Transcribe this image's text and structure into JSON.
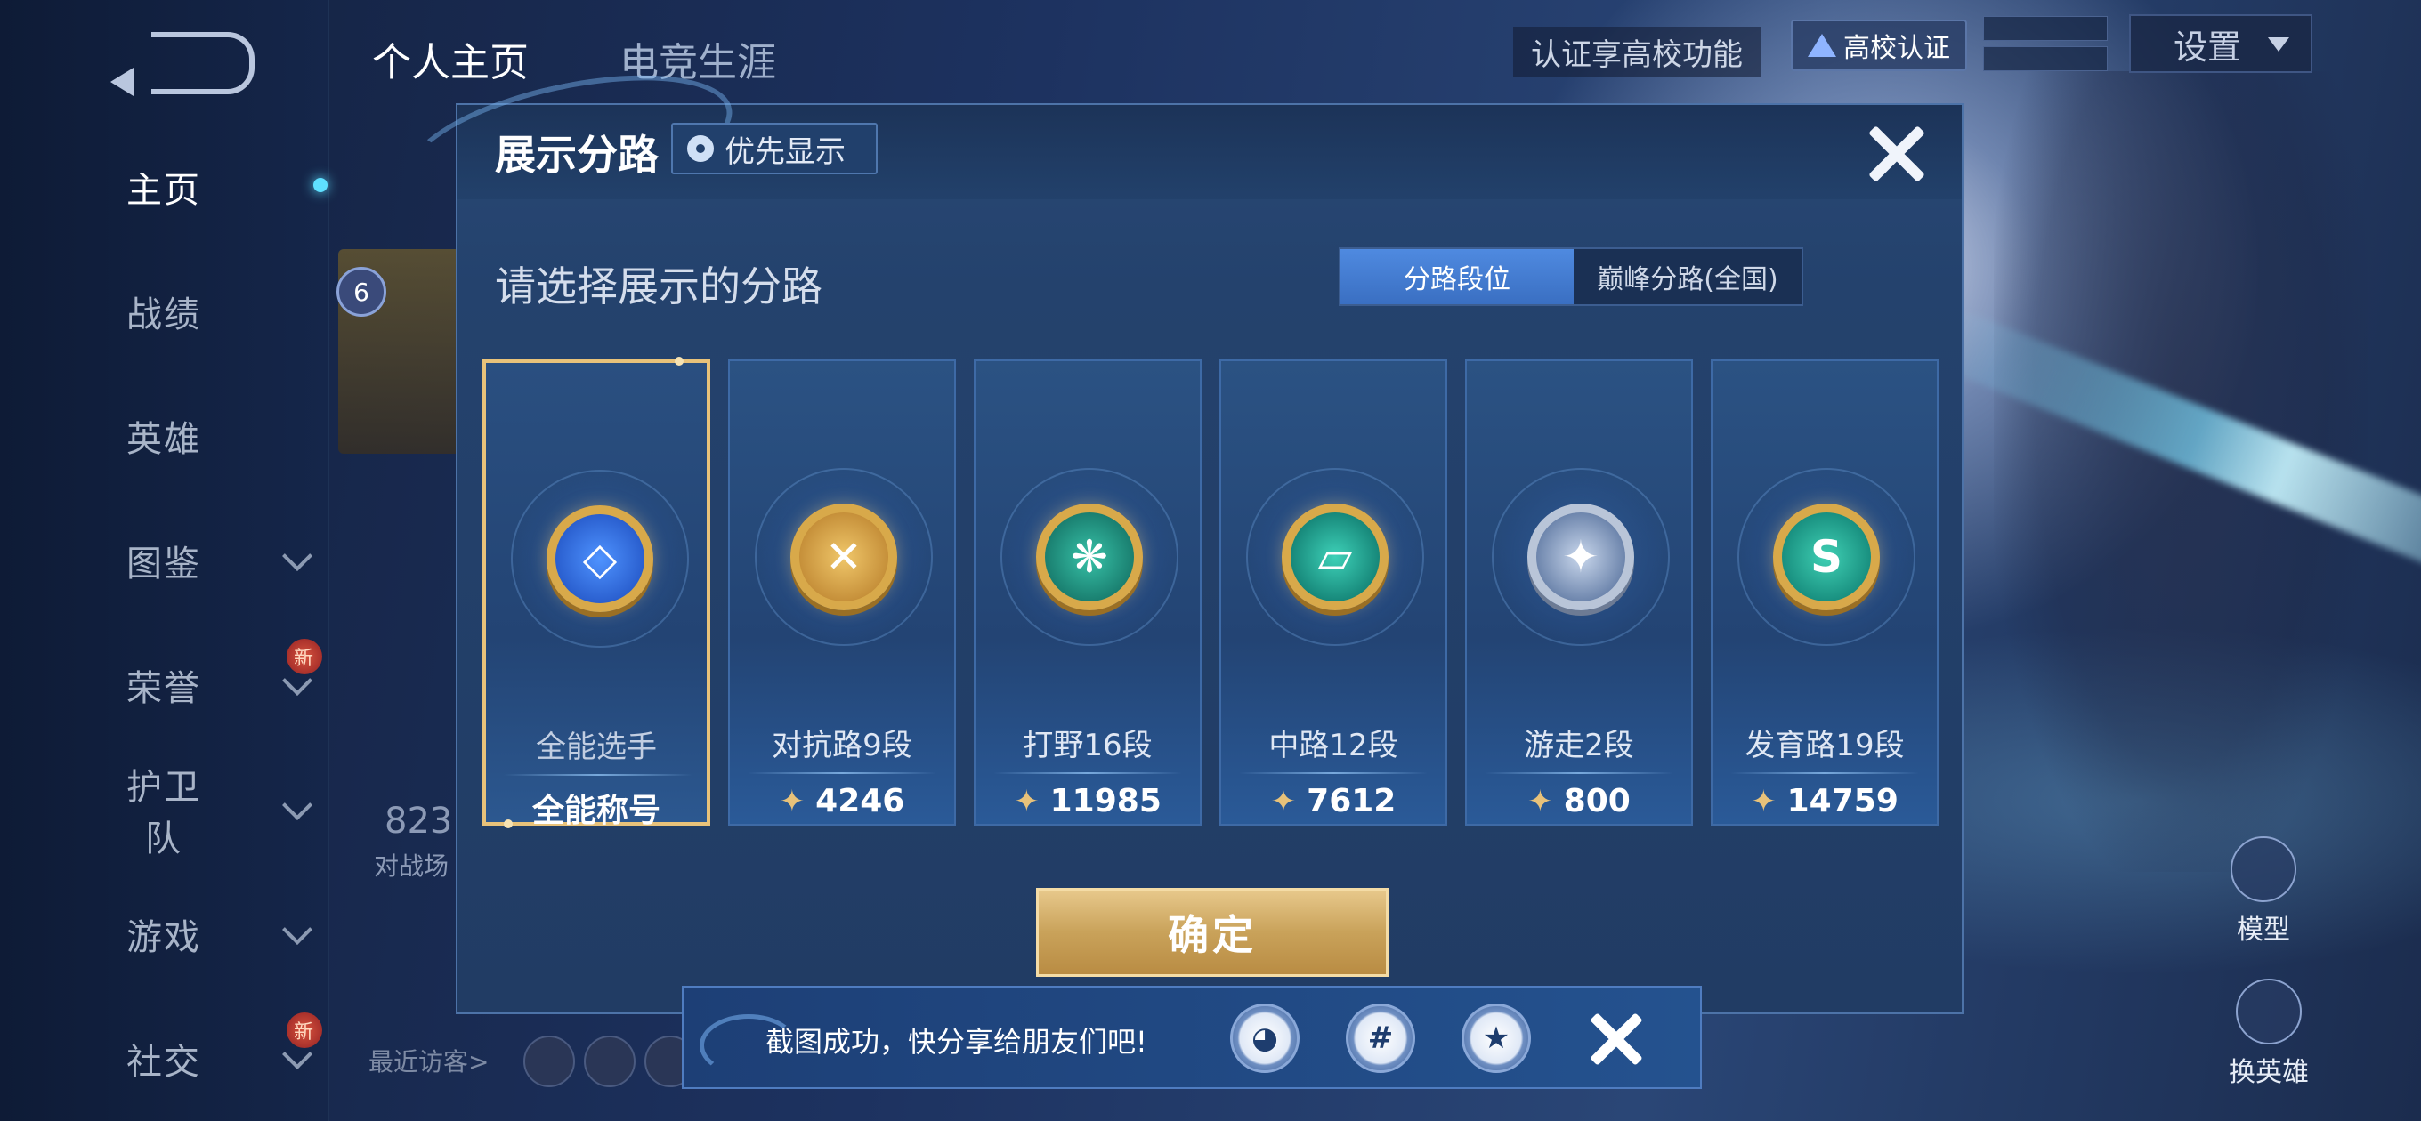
{
  "sidebar": {
    "items": [
      {
        "label": "主页",
        "active": true,
        "has_chevron": false,
        "badge": ""
      },
      {
        "label": "战绩",
        "active": false,
        "has_chevron": false,
        "badge": ""
      },
      {
        "label": "英雄",
        "active": false,
        "has_chevron": false,
        "badge": ""
      },
      {
        "label": "图鉴",
        "active": false,
        "has_chevron": true,
        "badge": ""
      },
      {
        "label": "荣誉",
        "active": false,
        "has_chevron": true,
        "badge": "新"
      },
      {
        "label": "护卫队",
        "active": false,
        "has_chevron": true,
        "badge": ""
      },
      {
        "label": "游戏",
        "active": false,
        "has_chevron": true,
        "badge": ""
      },
      {
        "label": "社交",
        "active": false,
        "has_chevron": true,
        "badge": "新"
      }
    ]
  },
  "header": {
    "tab_profile": "个人主页",
    "tab_career": "电竞生涯",
    "cert_prompt": "认证享高校功能",
    "campus_cert": "高校认证",
    "settings": "设置"
  },
  "background": {
    "level": "6",
    "stat_number": "823",
    "stat_label": "对战场",
    "recent_visitors": "最近访客>",
    "model": "模型",
    "swap_hero": "换英雄"
  },
  "dialog": {
    "title": "展示分路",
    "priority_button": "优先显示",
    "prompt": "请选择展示的分路",
    "toggle": {
      "option_rank": "分路段位",
      "option_peak": "巅峰分路(全国)",
      "selected": "分路段位"
    },
    "lanes": [
      {
        "name": "全能选手",
        "value": "全能称号",
        "selected": true,
        "has_star": false,
        "icon": "allround-emblem-icon",
        "glyph": "◇"
      },
      {
        "name": "对抗路9段",
        "value": "4246",
        "selected": false,
        "has_star": true,
        "icon": "clash-lane-emblem-icon",
        "glyph": "✕"
      },
      {
        "name": "打野16段",
        "value": "11985",
        "selected": false,
        "has_star": true,
        "icon": "jungle-emblem-icon",
        "glyph": "❋"
      },
      {
        "name": "中路12段",
        "value": "7612",
        "selected": false,
        "has_star": true,
        "icon": "mid-lane-emblem-icon",
        "glyph": "▱"
      },
      {
        "name": "游走2段",
        "value": "800",
        "selected": false,
        "has_star": true,
        "icon": "roam-emblem-icon",
        "glyph": "✦"
      },
      {
        "name": "发育路19段",
        "value": "14759",
        "selected": false,
        "has_star": true,
        "icon": "farm-lane-emblem-icon",
        "glyph": "S"
      }
    ],
    "confirm": "确定"
  },
  "toast": {
    "message": "截图成功，快分享给朋友们吧!",
    "share_targets": [
      "qq-icon",
      "wechat-moments-icon",
      "qzone-icon"
    ],
    "share_glyphs": [
      "◕",
      "#",
      "★"
    ]
  },
  "colors": {
    "gold_accent": "#e8c27a",
    "toggle_active": "#4f8ae0",
    "dialog_bg": "#24426d"
  }
}
